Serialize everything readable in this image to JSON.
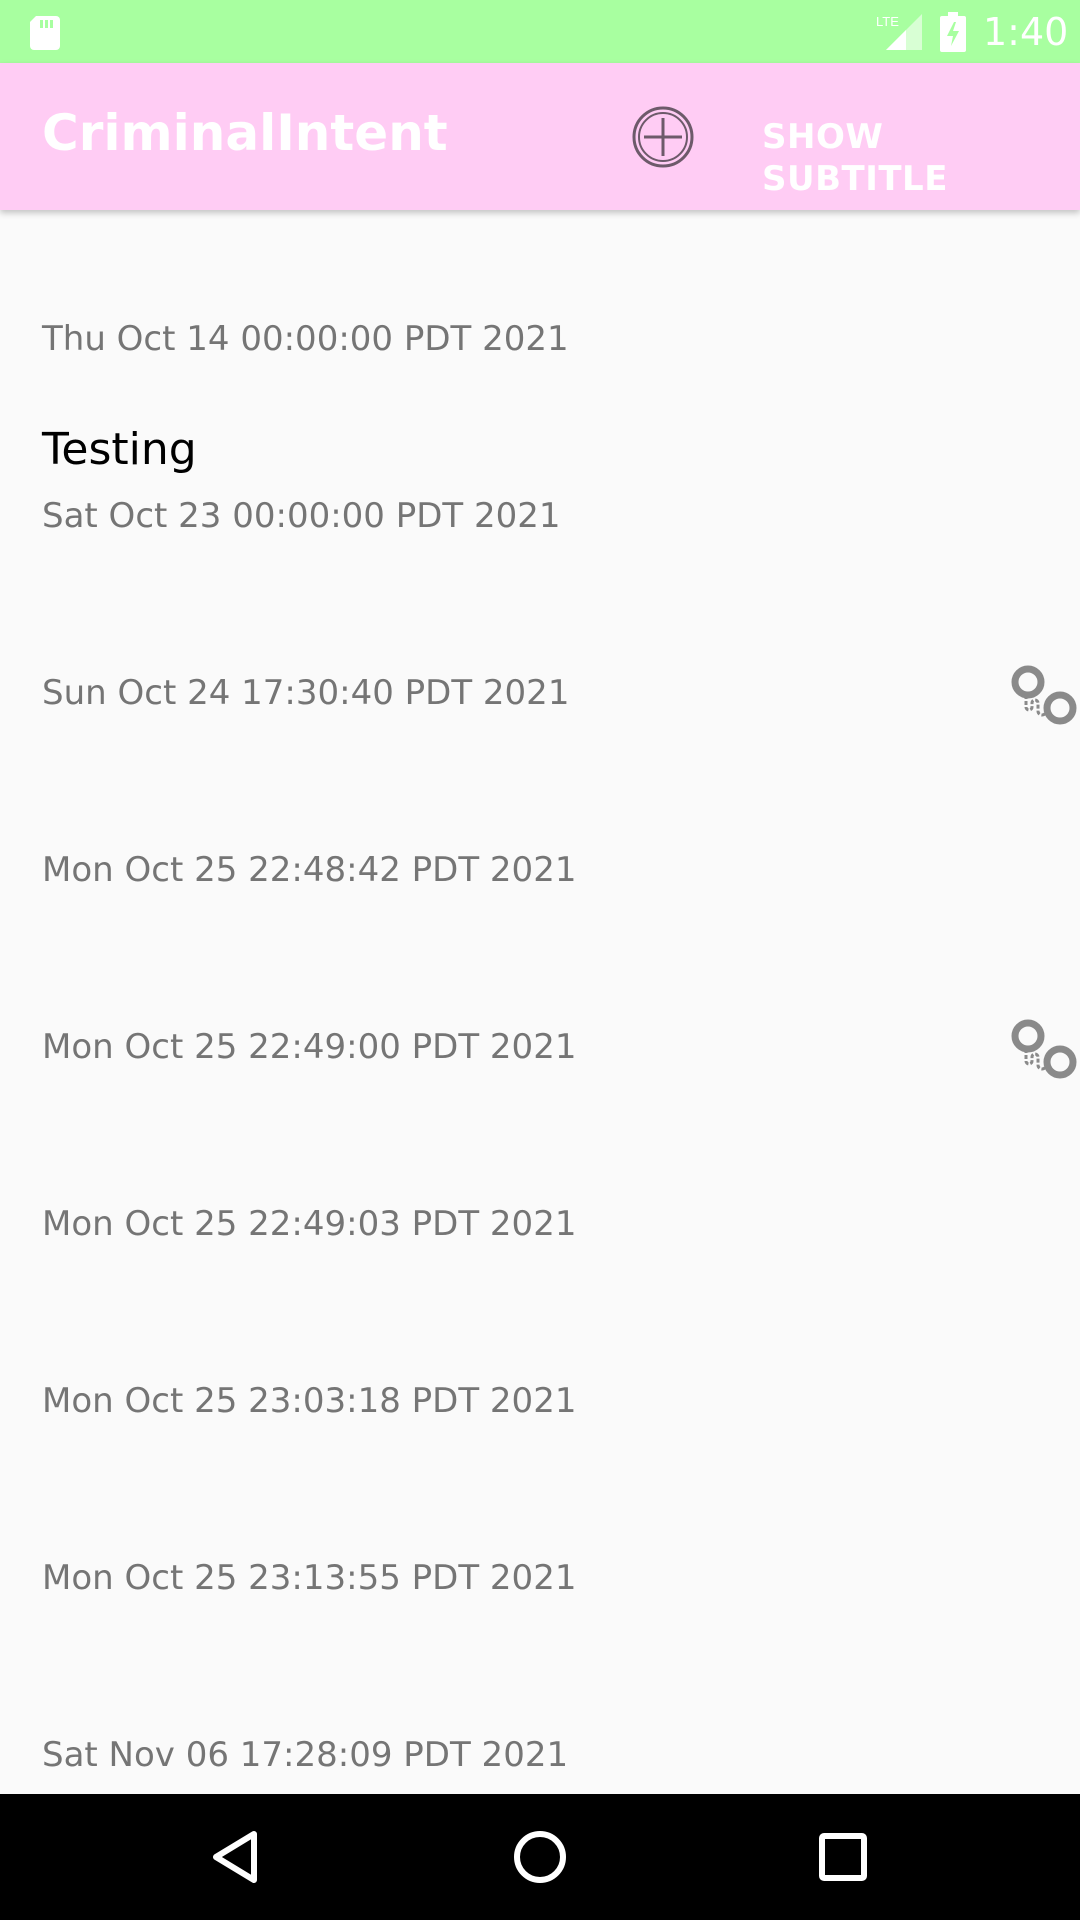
{
  "status_bar": {
    "time": "1:40",
    "network": "LTE",
    "icons": [
      "sd-card-icon",
      "lte-signal-icon",
      "battery-charging-icon"
    ]
  },
  "app_bar": {
    "title": "CriminalIntent",
    "add_icon": "add-circle-icon",
    "subtitle_button": "SHOW SUBTITLE"
  },
  "crimes": [
    {
      "title": "",
      "date": "Thu Oct 14 00:00:00 PDT 2021",
      "solved": false
    },
    {
      "title": "Testing",
      "date": "Sat Oct 23 00:00:00 PDT 2021",
      "solved": false
    },
    {
      "title": "",
      "date": "Sun Oct 24 17:30:40 PDT 2021",
      "solved": true
    },
    {
      "title": "",
      "date": "Mon Oct 25 22:48:42 PDT 2021",
      "solved": false
    },
    {
      "title": "",
      "date": "Mon Oct 25 22:49:00 PDT 2021",
      "solved": true
    },
    {
      "title": "",
      "date": "Mon Oct 25 22:49:03 PDT 2021",
      "solved": false
    },
    {
      "title": "",
      "date": "Mon Oct 25 23:03:18 PDT 2021",
      "solved": false
    },
    {
      "title": "",
      "date": "Mon Oct 25 23:13:55 PDT 2021",
      "solved": false
    },
    {
      "title": "",
      "date": "Sat Nov 06 17:28:09 PDT 2021",
      "solved": false
    }
  ],
  "nav_bar": {
    "icons": [
      "back-icon",
      "home-icon",
      "recents-icon"
    ]
  },
  "colors": {
    "status_bar": "#a8ffa0",
    "app_bar": "#ffccf4",
    "background": "#fafafa",
    "date_text": "#757575"
  }
}
